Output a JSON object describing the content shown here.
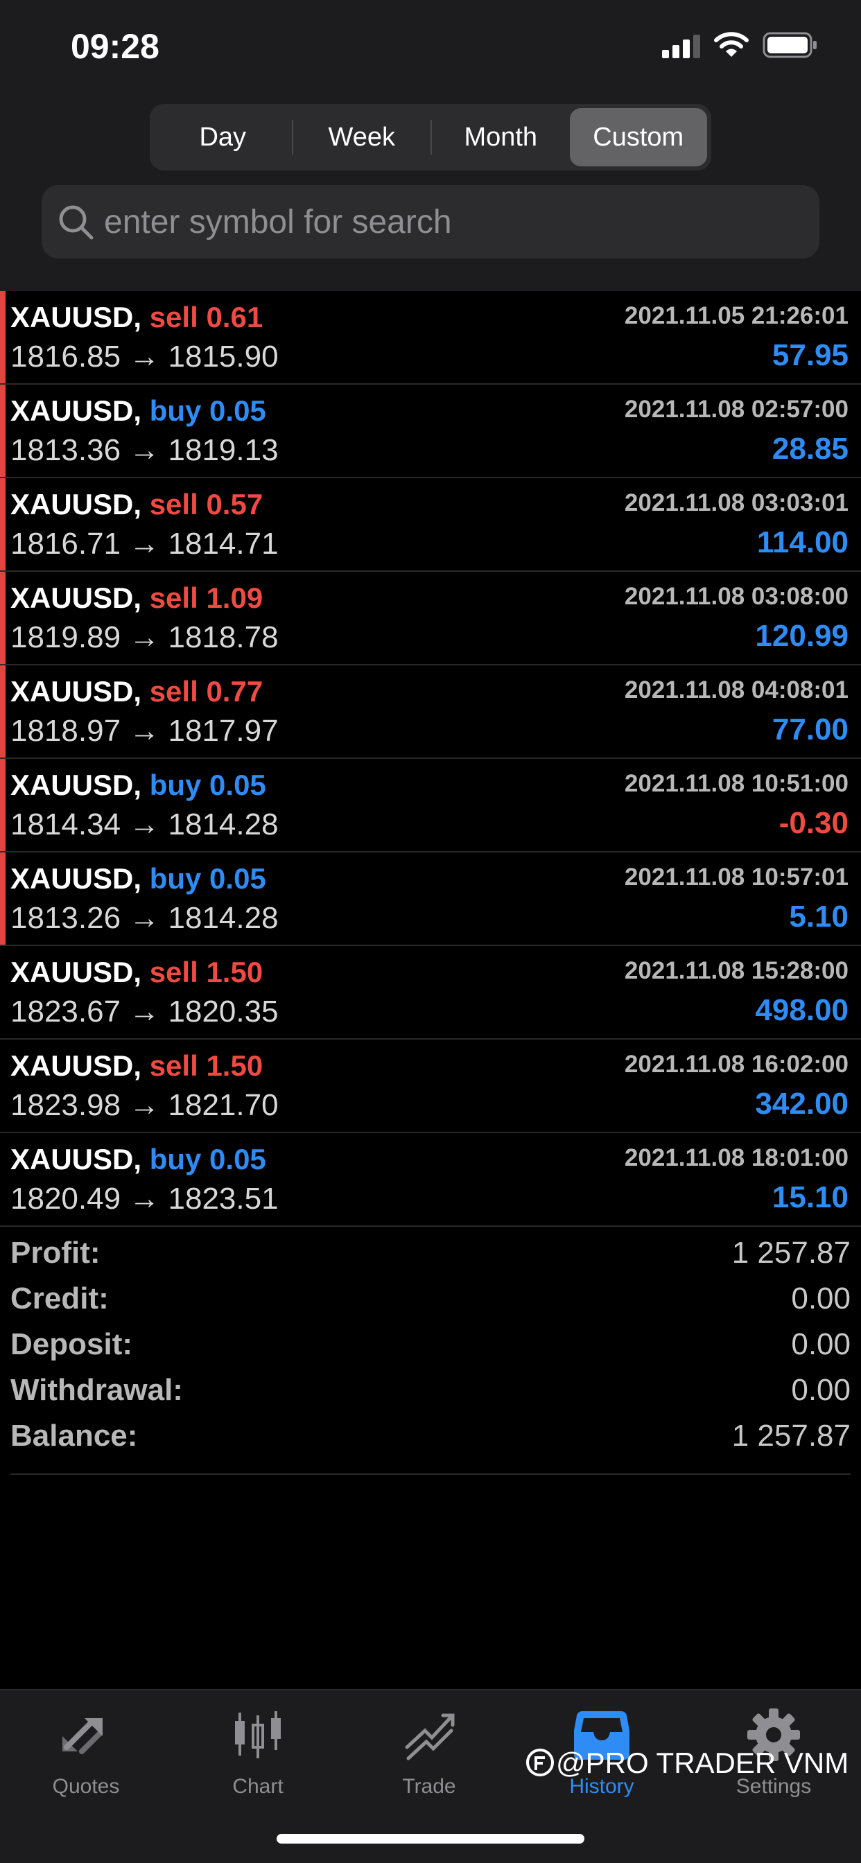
{
  "status_bar": {
    "time": "09:28"
  },
  "period_tabs": [
    {
      "label": "Day",
      "active": false
    },
    {
      "label": "Week",
      "active": false
    },
    {
      "label": "Month",
      "active": false
    },
    {
      "label": "Custom",
      "active": true
    }
  ],
  "search": {
    "placeholder": "enter symbol for search",
    "value": ""
  },
  "deals": [
    {
      "symbol": "XAUUSD,",
      "type": "sell",
      "volume": "0.61",
      "prices": "1816.85 → 1815.90",
      "time": "2021.11.05 21:26:01",
      "profit": "57.95",
      "flag": true
    },
    {
      "symbol": "XAUUSD,",
      "type": "buy",
      "volume": "0.05",
      "prices": "1813.36 → 1819.13",
      "time": "2021.11.08 02:57:00",
      "profit": "28.85",
      "flag": true
    },
    {
      "symbol": "XAUUSD,",
      "type": "sell",
      "volume": "0.57",
      "prices": "1816.71 → 1814.71",
      "time": "2021.11.08 03:03:01",
      "profit": "114.00",
      "flag": true
    },
    {
      "symbol": "XAUUSD,",
      "type": "sell",
      "volume": "1.09",
      "prices": "1819.89 → 1818.78",
      "time": "2021.11.08 03:08:00",
      "profit": "120.99",
      "flag": true
    },
    {
      "symbol": "XAUUSD,",
      "type": "sell",
      "volume": "0.77",
      "prices": "1818.97 → 1817.97",
      "time": "2021.11.08 04:08:01",
      "profit": "77.00",
      "flag": true
    },
    {
      "symbol": "XAUUSD,",
      "type": "buy",
      "volume": "0.05",
      "prices": "1814.34 → 1814.28",
      "time": "2021.11.08 10:51:00",
      "profit": "-0.30",
      "flag": true
    },
    {
      "symbol": "XAUUSD,",
      "type": "buy",
      "volume": "0.05",
      "prices": "1813.26 → 1814.28",
      "time": "2021.11.08 10:57:01",
      "profit": "5.10",
      "flag": true
    },
    {
      "symbol": "XAUUSD,",
      "type": "sell",
      "volume": "1.50",
      "prices": "1823.67 → 1820.35",
      "time": "2021.11.08 15:28:00",
      "profit": "498.00",
      "flag": false
    },
    {
      "symbol": "XAUUSD,",
      "type": "sell",
      "volume": "1.50",
      "prices": "1823.98 → 1821.70",
      "time": "2021.11.08 16:02:00",
      "profit": "342.00",
      "flag": false
    },
    {
      "symbol": "XAUUSD,",
      "type": "buy",
      "volume": "0.05",
      "prices": "1820.49 → 1823.51",
      "time": "2021.11.08 18:01:00",
      "profit": "15.10",
      "flag": false
    }
  ],
  "summary": [
    {
      "label": "Profit:",
      "value": "1 257.87"
    },
    {
      "label": "Credit:",
      "value": "0.00"
    },
    {
      "label": "Deposit:",
      "value": "0.00"
    },
    {
      "label": "Withdrawal:",
      "value": "0.00"
    },
    {
      "label": "Balance:",
      "value": "1 257.87"
    }
  ],
  "tabbar": [
    {
      "label": "Quotes",
      "icon": "quotes-icon",
      "active": false
    },
    {
      "label": "Chart",
      "icon": "chart-icon",
      "active": false
    },
    {
      "label": "Trade",
      "icon": "trade-icon",
      "active": false
    },
    {
      "label": "History",
      "icon": "history-icon",
      "active": true
    },
    {
      "label": "Settings",
      "icon": "gear-icon",
      "active": false
    }
  ],
  "watermark": "@PRO TRADER VNM",
  "colors": {
    "sell": "#f04a42",
    "buy": "#2f8cf5",
    "accent": "#2f8cf5",
    "flag": "#e0463d"
  }
}
